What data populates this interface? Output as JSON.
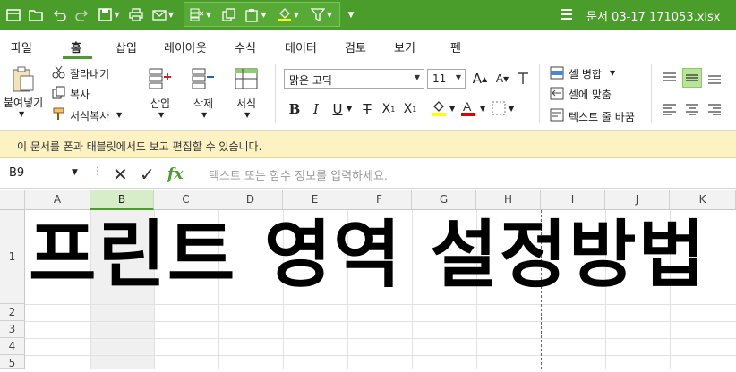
{
  "title_bar": {
    "document_title": "문서 03-17 171053.xlsx",
    "bg_color": "#4a9c2b",
    "quick_access_icons": [
      "menu-icon",
      "open-folder-icon",
      "undo-icon",
      "redo-icon",
      "save-icon",
      "print-icon",
      "mail-icon",
      "insert-cells-icon",
      "copy-format-icon",
      "paste-special-icon",
      "fill-color-icon",
      "filter-icon",
      "more-icon"
    ]
  },
  "tabs": [
    {
      "label": "파일"
    },
    {
      "label": "홈",
      "active": true
    },
    {
      "label": "삽입"
    },
    {
      "label": "레이아웃"
    },
    {
      "label": "수식"
    },
    {
      "label": "데이터"
    },
    {
      "label": "검토"
    },
    {
      "label": "보기"
    },
    {
      "label": "펜"
    }
  ],
  "ribbon": {
    "paste": "붙여넣기",
    "cut": "잘라내기",
    "copy": "복사",
    "format_painter": "서식복사",
    "insert": "삽입",
    "delete": "삭제",
    "format": "서식",
    "font_name": "맑은 고딕",
    "font_size": "11",
    "merge_cells": "셀 병합",
    "fit_cell": "셀에 맞춤",
    "wrap_text": "텍스트 줄 바꿈",
    "fill_color": "#ffff00",
    "font_color": "#e00000"
  },
  "info_bar": {
    "message": "이 문서를 폰과 태블릿에서도 보고 편집할 수 있습니다."
  },
  "formula_bar": {
    "name_box": "B9",
    "placeholder": "텍스트 또는 함수 정보를 입력하세요."
  },
  "sheet": {
    "columns": [
      "A",
      "B",
      "C",
      "D",
      "E",
      "F",
      "G",
      "H",
      "I",
      "J",
      "K"
    ],
    "selected_column": "B",
    "rows": [
      "1",
      "2",
      "3",
      "4",
      "5"
    ],
    "cell_text": "프린트 영역 설정방법"
  }
}
